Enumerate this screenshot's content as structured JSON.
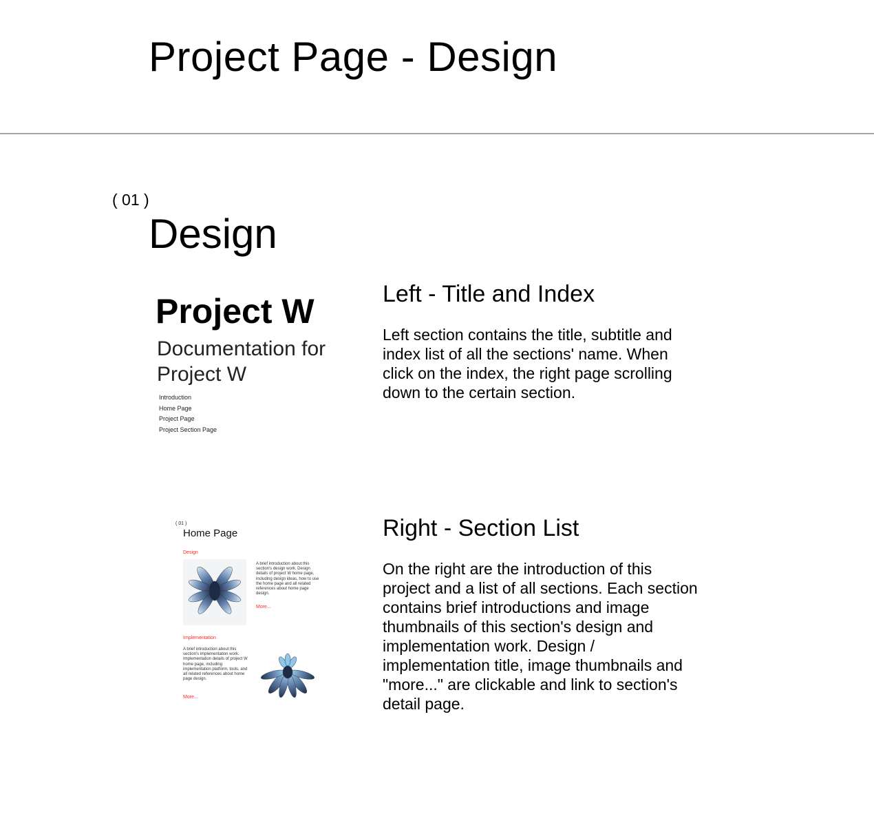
{
  "header": {
    "title": "Project Page - Design"
  },
  "section": {
    "number": "( 01 )",
    "title": "Design"
  },
  "thumbnail_left": {
    "title": "Project W",
    "subtitle": "Documentation for Project W",
    "index": [
      "Introduction",
      "Home Page",
      "Project Page",
      "Project Section Page"
    ]
  },
  "thumbnail_right": {
    "number": "( 01 )",
    "heading": "Home Page",
    "design_label": "Design",
    "design_text": "A brief introduction about this section's design work. Design details of project W home page, including design ideas, how to use the home page and all related references about home page design.",
    "design_more": "More...",
    "implementation_label": "Implementation",
    "implementation_text": "A brief introduction about this section's implementation work. Implementation details of project W home page, including implementation platform, tools, and all related references about home page design.",
    "implementation_more": "More..."
  },
  "descriptions": [
    {
      "title": "Left - Title and Index",
      "text": "Left section contains the title, subtitle and index list of all the sections' name. When click on the index, the right page scrolling down to the certain section."
    },
    {
      "title": "Right - Section List",
      "text": "On the right are the introduction of this project and a list of all sections. Each section contains brief introductions and image thumbnails of this section's design and implementation work. Design / implementation title, image thumbnails and \"more...\" are clickable and link to section's detail page."
    }
  ],
  "colors": {
    "accent_red": "#ff2a2a",
    "divider": "#a6a6a6",
    "flower_blue": "#5f7fa8"
  },
  "icons": [
    "flower-image",
    "flower-image"
  ]
}
